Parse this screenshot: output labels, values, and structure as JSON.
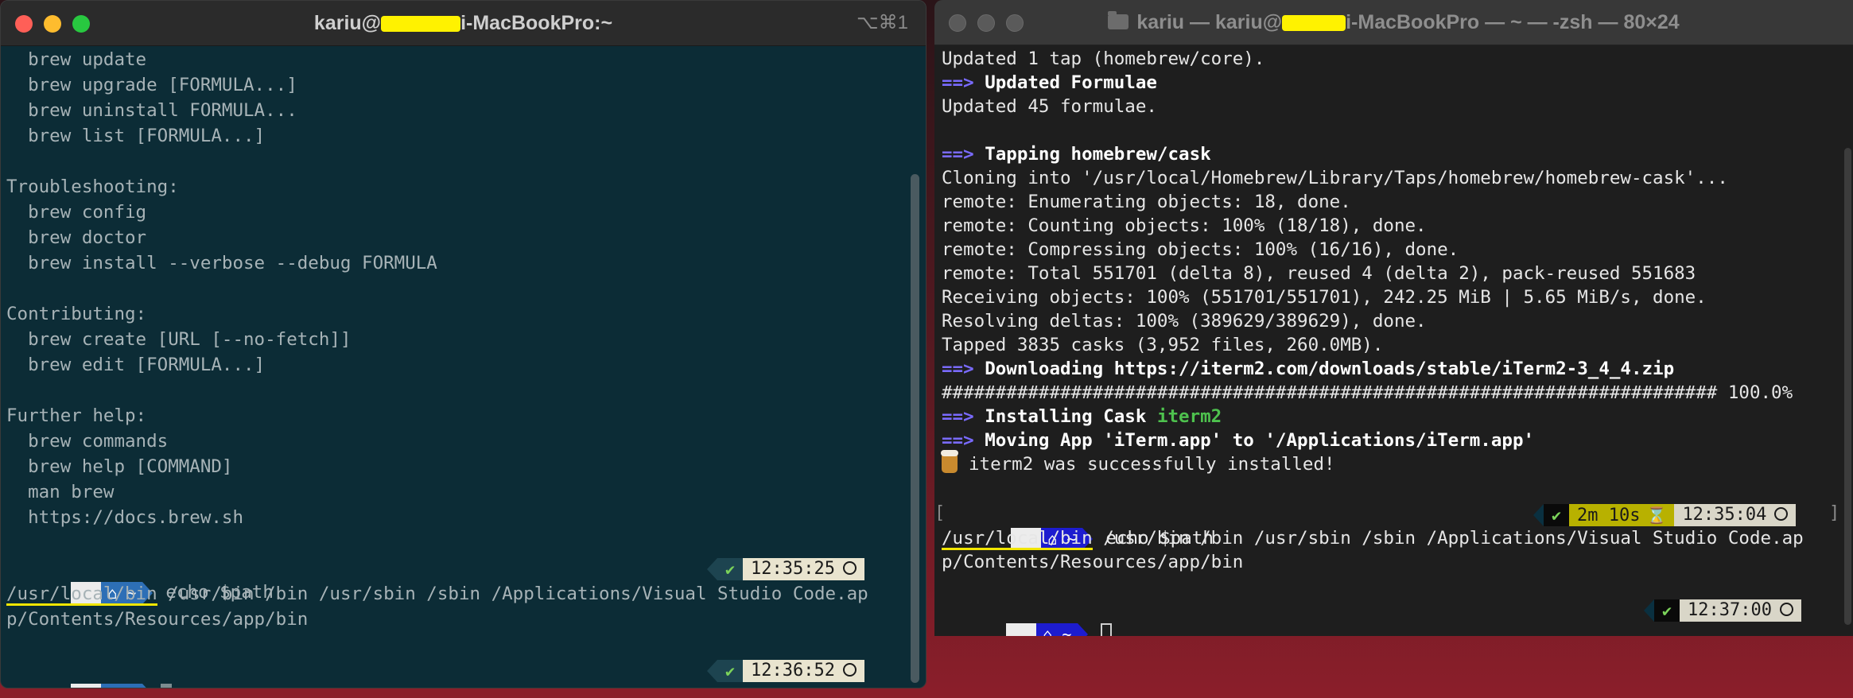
{
  "left": {
    "title_prefix": "kariu@",
    "title_suffix": "i-MacBookPro:~",
    "shortcut": "⌥⌘1",
    "lines": [
      "  brew update",
      "  brew upgrade [FORMULA...]",
      "  brew uninstall FORMULA...",
      "  brew list [FORMULA...]",
      "",
      "Troubleshooting:",
      "  brew config",
      "  brew doctor",
      "  brew install --verbose --debug FORMULA",
      "",
      "Contributing:",
      "  brew create [URL [--no-fetch]]",
      "  brew edit [FORMULA...]",
      "",
      "Further help:",
      "  brew commands",
      "  brew help [COMMAND]",
      "  man brew",
      "  https://docs.brew.sh"
    ],
    "prompt1": {
      "apple": "",
      "home": "⌂ ~",
      "command": "echo $path",
      "check": "✔",
      "time": "12:35:25"
    },
    "path_underlined": "/usr/local/bin",
    "path_rest": " /usr/bin /bin /usr/sbin /sbin /Applications/Visual Studio Code.ap",
    "path_line2": "p/Contents/Resources/app/bin",
    "prompt2": {
      "apple": "",
      "home": "⌂ ~",
      "check": "✔",
      "time": "12:36:52"
    }
  },
  "right": {
    "title_prefix": "kariu — kariu@",
    "title_suffix": "i-MacBookPro — ~ — -zsh — 80×24",
    "line_updated_tap": "Updated 1 tap (homebrew/core).",
    "arrow": "==>",
    "updated_formulae": "Updated Formulae",
    "line_updated_45": "Updated 45 formulae.",
    "tapping": "Tapping homebrew/cask",
    "remote_lines": [
      "Cloning into '/usr/local/Homebrew/Library/Taps/homebrew/homebrew-cask'...",
      "remote: Enumerating objects: 18, done.",
      "remote: Counting objects: 100% (18/18), done.",
      "remote: Compressing objects: 100% (16/16), done.",
      "remote: Total 551701 (delta 8), reused 4 (delta 2), pack-reused 551683",
      "Receiving objects: 100% (551701/551701), 242.25 MiB | 5.65 MiB/s, done.",
      "Resolving deltas: 100% (389629/389629), done.",
      "Tapped 3835 casks (3,952 files, 260.0MB)."
    ],
    "downloading": "Downloading https://iterm2.com/downloads/stable/iTerm2-3_4_4.zip",
    "progress_bar": "######################################################################## 100.0%",
    "installing_cask": "Installing Cask ",
    "cask_name": "iterm2",
    "moving_app": "Moving App 'iTerm.app' to '/Applications/iTerm.app'",
    "installed": "iterm2 was successfully installed!",
    "prompt1": {
      "apple": "",
      "home": "⌂ ~",
      "command": "echo $path",
      "check": "✔",
      "duration": "2m 10s",
      "hourglass": "⌛",
      "time": "12:35:04"
    },
    "path_underlined": "/usr/local/bin",
    "path_rest": " /usr/bin /bin /usr/sbin /sbin /Applications/Visual Studio Code.ap",
    "path_line2": "p/Contents/Resources/app/bin",
    "prompt2": {
      "apple": "",
      "home": "⌂ ~",
      "check": "✔",
      "time": "12:37:00"
    }
  }
}
